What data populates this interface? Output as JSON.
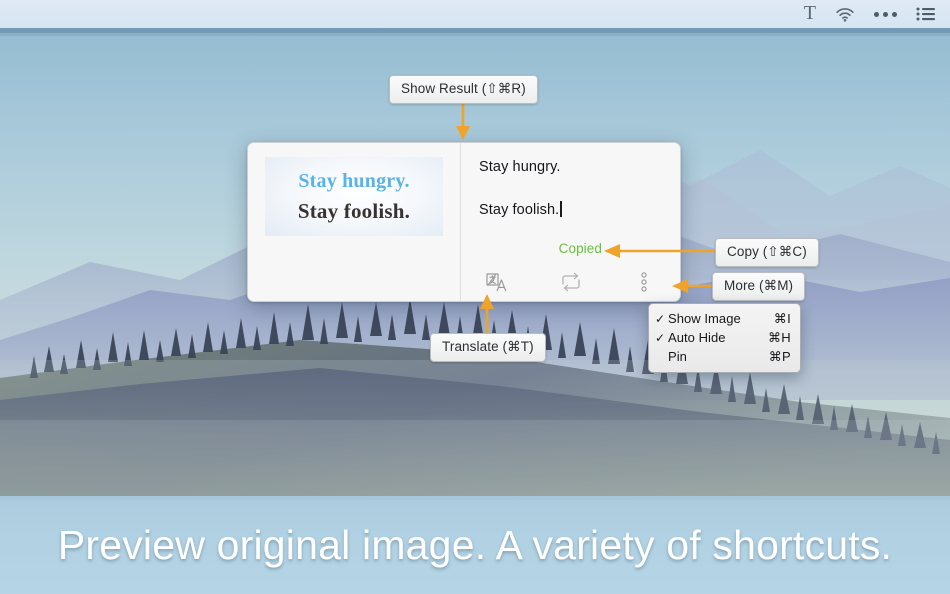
{
  "menubar": {
    "items": [
      {
        "name": "text-tool-icon",
        "label": "T"
      },
      {
        "name": "wifi-icon",
        "label": ""
      },
      {
        "name": "more-dots-icon",
        "label": ""
      },
      {
        "name": "list-menu-icon",
        "label": ""
      }
    ]
  },
  "popup": {
    "thumbnail": {
      "line1": "Stay hungry.",
      "line2": "Stay foolish.",
      "line1_color": "#57b3e8",
      "line2_color": "#3a3230"
    },
    "result": {
      "line1": "Stay hungry.",
      "line2": "Stay foolish."
    },
    "status": {
      "label": "Copied",
      "color": "#6cbf3f"
    },
    "toolbar": {
      "translate_icon": "translate-icon",
      "refresh_icon": "refresh-icon",
      "more_icon": "more-vertical-dots-icon"
    }
  },
  "callouts": {
    "show_result": "Show Result (⇧⌘R)",
    "copy": "Copy (⇧⌘C)",
    "more": "More (⌘M)",
    "translate": "Translate (⌘T)",
    "arrow_color": "#f0a32a"
  },
  "dropdown": {
    "items": [
      {
        "check": "✓",
        "label": "Show Image",
        "shortcut": "⌘I"
      },
      {
        "check": "✓",
        "label": "Auto Hide",
        "shortcut": "⌘H"
      },
      {
        "check": "",
        "label": "Pin",
        "shortcut": "⌘P"
      }
    ]
  },
  "banner": {
    "caption": "Preview original image. A variety of shortcuts."
  }
}
